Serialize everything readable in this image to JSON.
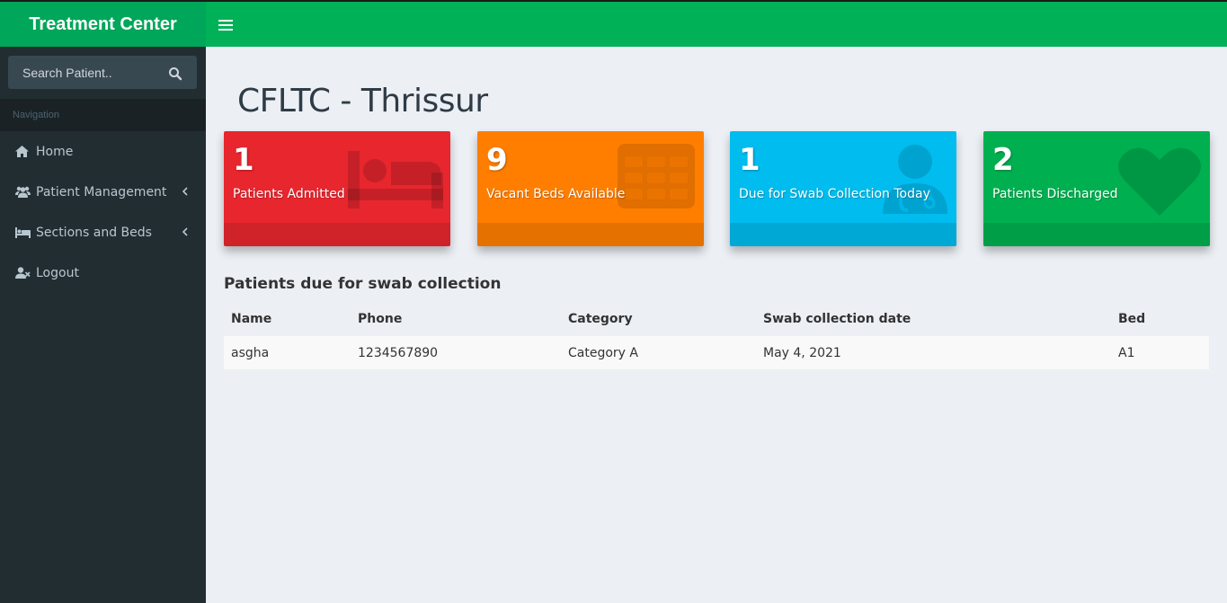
{
  "app": {
    "title": "Treatment Center"
  },
  "search": {
    "placeholder": "Search Patient.."
  },
  "sidebar": {
    "header": "Navigation",
    "items": [
      {
        "label": "Home",
        "icon": "home-icon"
      },
      {
        "label": "Patient Management",
        "icon": "users-icon",
        "expandable": true
      },
      {
        "label": "Sections and Beds",
        "icon": "bed-icon",
        "expandable": true
      },
      {
        "label": "Logout",
        "icon": "user-times-icon"
      }
    ]
  },
  "page": {
    "title": "CFLTC - Thrissur"
  },
  "stats": [
    {
      "value": "1",
      "label": "Patients Admitted",
      "icon": "bed-icon",
      "color": "#e8262e"
    },
    {
      "value": "9",
      "label": "Vacant Beds Available",
      "icon": "calendar-grid-icon",
      "color": "#ff7e00"
    },
    {
      "value": "1",
      "label": "Due for Swab Collection Today",
      "icon": "user-doctor-icon",
      "color": "#00bcef"
    },
    {
      "value": "2",
      "label": "Patients Discharged",
      "icon": "heart-icon",
      "color": "#00b050"
    }
  ],
  "swab": {
    "title": "Patients due for swab collection",
    "columns": [
      "Name",
      "Phone",
      "Category",
      "Swab collection date",
      "Bed"
    ],
    "rows": [
      [
        "asgha",
        "1234567890",
        "Category A",
        "May 4, 2021",
        "A1"
      ]
    ]
  },
  "colors": {
    "header": "#00b158",
    "logo": "#00a65a",
    "sidebar": "#222d32"
  }
}
